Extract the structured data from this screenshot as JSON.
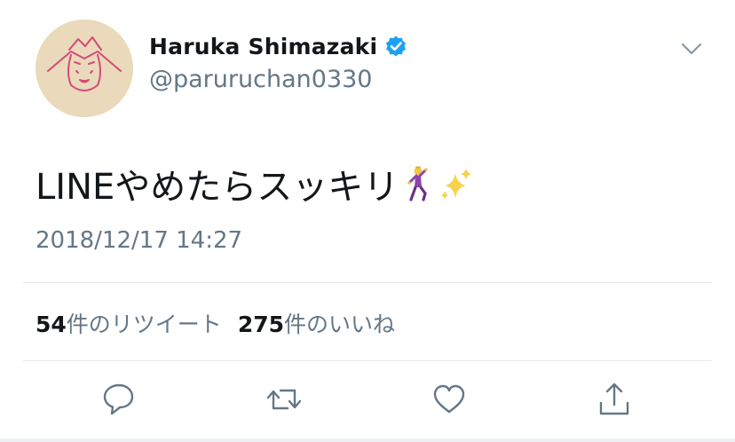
{
  "user": {
    "display_name": "Haruka Shimazaki",
    "handle": "@paruruchan0330",
    "verified": true
  },
  "tweet": {
    "text": "LINEやめたらスッキリ",
    "emojis": [
      "man-dancing-icon",
      "sparkles-icon"
    ],
    "timestamp": "2018/12/17 14:27"
  },
  "stats": {
    "retweets_count": "54",
    "retweets_label": "件のリツイート",
    "likes_count": "275",
    "likes_label": "件のいいね"
  },
  "actions": [
    "reply-icon",
    "retweet-icon",
    "like-icon",
    "share-icon"
  ],
  "colors": {
    "accent": "#1da1f2",
    "secondary_text": "#657786",
    "divider": "#e1e8ed",
    "avatar_bg": "#ead9bb",
    "avatar_drawing": "#d64a78"
  }
}
